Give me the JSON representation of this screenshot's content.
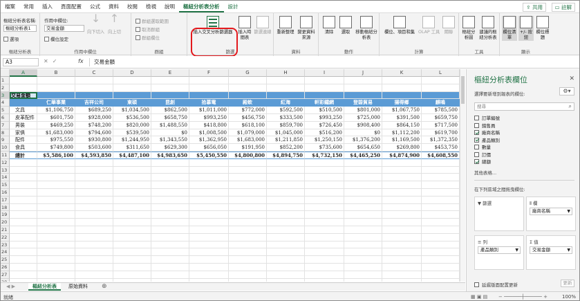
{
  "tabs": [
    "檔案",
    "常用",
    "插入",
    "頁面配置",
    "公式",
    "資料",
    "校閱",
    "檢視",
    "說明",
    "樞紐分析表分析",
    "設計"
  ],
  "share_label": "共用",
  "comment_label": "註解",
  "ribbon": {
    "pivot_group": {
      "name_label": "樞紐分析表名稱:",
      "name_value": "樞紐分析表1",
      "options_label": "選項",
      "label": "樞紐分析表"
    },
    "active_field_group": {
      "field_label": "作用中欄位:",
      "field_value": "交易金額",
      "settings_label": "欄位設定",
      "drill_down": "向下切入",
      "drill_up": "向上切",
      "label": "作用中欄位"
    },
    "group_group": {
      "items": [
        "群組選取範圍",
        "取消群組",
        "群組欄位"
      ],
      "label": "群組"
    },
    "filter_group": {
      "slicer_label": "插入交叉分析篩選器",
      "timeline_label": "插入時間表",
      "connections_label": "篩選連線",
      "label": "篩選"
    },
    "data_group": {
      "refresh_label": "重新整理",
      "source_label": "變更資料來源",
      "label": "資料"
    },
    "actions_group": {
      "clear_label": "清除",
      "select_label": "選取",
      "move_label": "移動樞紐分析表",
      "label": "動作"
    },
    "calc_group": {
      "fields_label": "欄位、項目和集",
      "olap_label": "OLAP 工具",
      "relations_label": "關聯",
      "label": "計算"
    },
    "tools_group": {
      "chart_label": "樞紐分析圖",
      "recommended_label": "建議的樞紐分析表",
      "label": "工具"
    },
    "show_group": {
      "field_list_label": "欄位清單",
      "buttons_label": "+/- 按鈕",
      "headers_label": "欄位標題",
      "label": "顯示"
    }
  },
  "formula_bar": {
    "cell_ref": "A3",
    "fx": "fx",
    "value": "交易金額"
  },
  "columns": [
    "A",
    "B",
    "C",
    "D",
    "E",
    "F",
    "G",
    "H",
    "I",
    "J",
    "K",
    "L"
  ],
  "selected_column": "A",
  "selected_row": "3",
  "row_numbers": [
    "1",
    "2",
    "3",
    "4",
    "5",
    "6",
    "7",
    "8",
    "9",
    "10",
    "11",
    "12",
    "13",
    "14",
    "15",
    "16",
    "17",
    "18",
    "19",
    "20",
    "21",
    "22",
    "23",
    "24",
    "25",
    "26",
    "27",
    "28"
  ],
  "pivot": {
    "title": "交易金額",
    "headers": [
      "",
      "仁華事業",
      "吉祥公司",
      "東碩",
      "昆創",
      "拾慕電",
      "殿軟",
      "紅海",
      "軒彩鐵網",
      "登碧貿易",
      "揚得鄉",
      "麒鳴"
    ],
    "rows": [
      [
        "文具",
        "$1,106,750",
        "$689,250",
        "$1,034,500",
        "$862,500",
        "$1,011,000",
        "$772,000",
        "$592,500",
        "$510,500",
        "$801,000",
        "$1,067,750",
        "$785,500"
      ],
      [
        "皮革配件",
        "$601,750",
        "$928,000",
        "$536,500",
        "$658,750",
        "$993,250",
        "$456,750",
        "$333,500",
        "$993,250",
        "$725,000",
        "$391,500",
        "$659,750"
      ],
      [
        "男裝",
        "$469,250",
        "$748,200",
        "$820,000",
        "$1,488,550",
        "$418,800",
        "$618,100",
        "$859,700",
        "$726,450",
        "$908,400",
        "$864,150",
        "$717,500"
      ],
      [
        "家俱",
        "$1,683,000",
        "$794,600",
        "$539,500",
        "$0",
        "$1,008,500",
        "$1,079,000",
        "$1,045,000",
        "$516,200",
        "$0",
        "$1,112,200",
        "$619,700"
      ],
      [
        "配件",
        "$975,550",
        "$930,800",
        "$1,244,950",
        "$1,343,550",
        "$1,362,950",
        "$1,683,000",
        "$1,211,850",
        "$1,250,150",
        "$1,376,200",
        "$1,169,500",
        "$1,372,350"
      ],
      [
        "食具",
        "$749,800",
        "$503,600",
        "$311,650",
        "$629,300",
        "$656,050",
        "$191,950",
        "$852,200",
        "$735,600",
        "$654,650",
        "$269,800",
        "$453,750"
      ]
    ],
    "total": [
      "總計",
      "$5,586,100",
      "$4,593,850",
      "$4,487,100",
      "$4,983,650",
      "$5,450,550",
      "$4,800,800",
      "$4,894,750",
      "$4,732,150",
      "$4,465,250",
      "$4,874,900",
      "$4,608,550"
    ]
  },
  "sheets": [
    "樞紐分析表",
    "原始資料"
  ],
  "active_sheet": "樞紐分析表",
  "status": {
    "ready": "就緒",
    "zoom": "100%"
  },
  "pane": {
    "title": "樞紐分析表欄位",
    "subtitle": "選擇要新增到報表的欄位:",
    "search_placeholder": "搜尋",
    "fields": [
      {
        "label": "訂單編號",
        "checked": false
      },
      {
        "label": "銷售員",
        "checked": false
      },
      {
        "label": "廠商名稱",
        "checked": true
      },
      {
        "label": "產品類別",
        "checked": true
      },
      {
        "label": "數量",
        "checked": false
      },
      {
        "label": "訂價",
        "checked": false
      },
      {
        "label": "總額",
        "checked": true
      }
    ],
    "more_tables": "其他表格...",
    "drag_hint": "在下列區域之間拖曳欄位:",
    "areas": {
      "filters": {
        "label": "篩選",
        "value": ""
      },
      "columns": {
        "label": "欄",
        "value": "廠商名稱"
      },
      "rows": {
        "label": "列",
        "value": "產品類別"
      },
      "values": {
        "label": "值",
        "value": "交易金額"
      }
    },
    "defer_label": "延遲版面配置更新",
    "update_label": "更新"
  }
}
